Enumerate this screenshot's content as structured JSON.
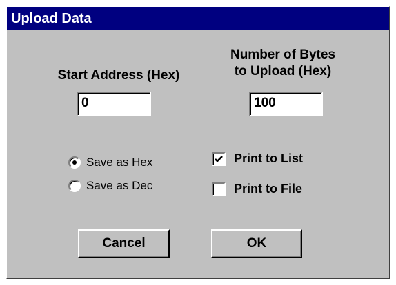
{
  "window": {
    "title": "Upload Data"
  },
  "start_address": {
    "label": "Start Address (Hex)",
    "value": "0"
  },
  "num_bytes": {
    "label_line1": "Number of Bytes",
    "label_line2": "to Upload (Hex)",
    "value": "100"
  },
  "format": {
    "options": [
      {
        "label": "Save as Hex",
        "selected": true
      },
      {
        "label": "Save as Dec",
        "selected": false
      }
    ]
  },
  "output": {
    "print_to_list": {
      "label": "Print to List",
      "checked": true
    },
    "print_to_file": {
      "label": "Print to File",
      "checked": false
    }
  },
  "buttons": {
    "cancel": "Cancel",
    "ok": "OK"
  },
  "colors": {
    "titlebar": "#000080",
    "face": "#c0c0c0"
  }
}
